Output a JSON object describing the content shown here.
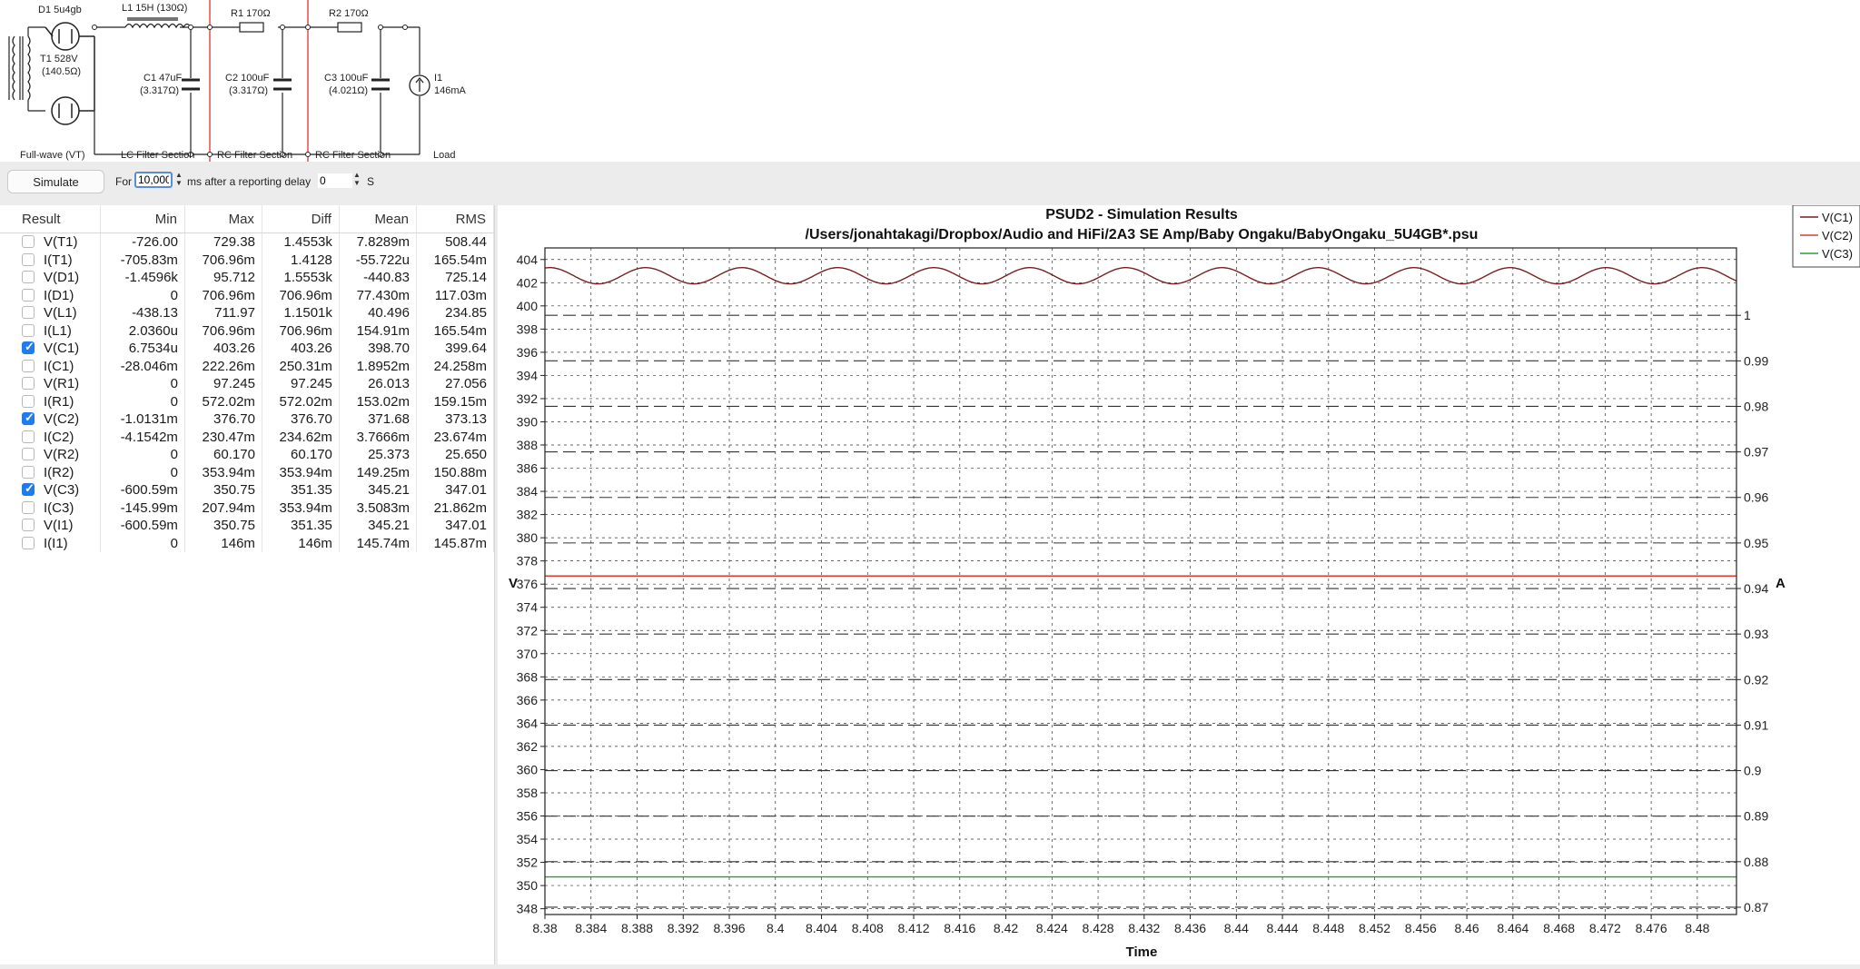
{
  "schematic": {
    "rectifier": "D1 5u4gb",
    "transformer": "T1 528V",
    "transformer_r": "(140.5Ω)",
    "inductor": "L1 15H (130Ω)",
    "r1": "R1 170Ω",
    "r2": "R2 170Ω",
    "c1": "C1 47uF",
    "c1_esr": "(3.317Ω)",
    "c2": "C2 100uF",
    "c2_esr": "(3.317Ω)",
    "c3": "C3 100uF",
    "c3_esr": "(4.021Ω)",
    "load": "I1",
    "load_current": "146mA",
    "sections": [
      "Full-wave (VT)",
      "LC Filter Section",
      "RC Filter Section",
      "RC Filter Section",
      "Load"
    ]
  },
  "controls": {
    "simulate_label": "Simulate",
    "for_label": "For",
    "duration_value": "10,000",
    "mid_label": "ms after a reporting delay",
    "delay_value": "0",
    "unit_label": "S"
  },
  "results": {
    "columns": [
      "Result",
      "Min",
      "Max",
      "Diff",
      "Mean",
      "RMS"
    ],
    "rows": [
      {
        "name": "V(T1)",
        "checked": false,
        "min": "-726.00",
        "max": "729.38",
        "diff": "1.4553k",
        "mean": "7.8289m",
        "rms": "508.44"
      },
      {
        "name": "I(T1)",
        "checked": false,
        "min": "-705.83m",
        "max": "706.96m",
        "diff": "1.4128",
        "mean": "-55.722u",
        "rms": "165.54m"
      },
      {
        "name": "V(D1)",
        "checked": false,
        "min": "-1.4596k",
        "max": "95.712",
        "diff": "1.5553k",
        "mean": "-440.83",
        "rms": "725.14"
      },
      {
        "name": "I(D1)",
        "checked": false,
        "min": "0",
        "max": "706.96m",
        "diff": "706.96m",
        "mean": "77.430m",
        "rms": "117.03m"
      },
      {
        "name": "V(L1)",
        "checked": false,
        "min": "-438.13",
        "max": "711.97",
        "diff": "1.1501k",
        "mean": "40.496",
        "rms": "234.85"
      },
      {
        "name": "I(L1)",
        "checked": false,
        "min": "2.0360u",
        "max": "706.96m",
        "diff": "706.96m",
        "mean": "154.91m",
        "rms": "165.54m"
      },
      {
        "name": "V(C1)",
        "checked": true,
        "min": "6.7534u",
        "max": "403.26",
        "diff": "403.26",
        "mean": "398.70",
        "rms": "399.64"
      },
      {
        "name": "I(C1)",
        "checked": false,
        "min": "-28.046m",
        "max": "222.26m",
        "diff": "250.31m",
        "mean": "1.8952m",
        "rms": "24.258m"
      },
      {
        "name": "V(R1)",
        "checked": false,
        "min": "0",
        "max": "97.245",
        "diff": "97.245",
        "mean": "26.013",
        "rms": "27.056"
      },
      {
        "name": "I(R1)",
        "checked": false,
        "min": "0",
        "max": "572.02m",
        "diff": "572.02m",
        "mean": "153.02m",
        "rms": "159.15m"
      },
      {
        "name": "V(C2)",
        "checked": true,
        "min": "-1.0131m",
        "max": "376.70",
        "diff": "376.70",
        "mean": "371.68",
        "rms": "373.13"
      },
      {
        "name": "I(C2)",
        "checked": false,
        "min": "-4.1542m",
        "max": "230.47m",
        "diff": "234.62m",
        "mean": "3.7666m",
        "rms": "23.674m"
      },
      {
        "name": "V(R2)",
        "checked": false,
        "min": "0",
        "max": "60.170",
        "diff": "60.170",
        "mean": "25.373",
        "rms": "25.650"
      },
      {
        "name": "I(R2)",
        "checked": false,
        "min": "0",
        "max": "353.94m",
        "diff": "353.94m",
        "mean": "149.25m",
        "rms": "150.88m"
      },
      {
        "name": "V(C3)",
        "checked": true,
        "min": "-600.59m",
        "max": "350.75",
        "diff": "351.35",
        "mean": "345.21",
        "rms": "347.01"
      },
      {
        "name": "I(C3)",
        "checked": false,
        "min": "-145.99m",
        "max": "207.94m",
        "diff": "353.94m",
        "mean": "3.5083m",
        "rms": "21.862m"
      },
      {
        "name": "V(I1)",
        "checked": false,
        "min": "-600.59m",
        "max": "350.75",
        "diff": "351.35",
        "mean": "345.21",
        "rms": "347.01"
      },
      {
        "name": "I(I1)",
        "checked": false,
        "min": "0",
        "max": "146m",
        "diff": "146m",
        "mean": "145.74m",
        "rms": "145.87m"
      }
    ]
  },
  "colors": {
    "v_c1": "#7a1f1f",
    "v_c2": "#e0392b",
    "v_c3": "#2e9a3e",
    "section_divider": "#e02020"
  },
  "chart_data": {
    "type": "line",
    "title": "PSUD2 - Simulation Results",
    "subtitle": "/Users/jonahtakagi/Dropbox/Audio and HiFi/2A3 SE Amp/Baby Ongaku/BabyOngaku_5U4GB*.psu",
    "xlabel": "Time",
    "ylabel": "V",
    "y2label": "A",
    "xlim": [
      8.38,
      8.4834
    ],
    "ylim": [
      347.5,
      405
    ],
    "y2lim": [
      0.8684,
      1.0148
    ],
    "x_ticks": [
      "8.38",
      "8.384",
      "8.388",
      "8.392",
      "8.396",
      "8.4",
      "8.404",
      "8.408",
      "8.412",
      "8.416",
      "8.42",
      "8.424",
      "8.428",
      "8.432",
      "8.436",
      "8.44",
      "8.444",
      "8.448",
      "8.452",
      "8.456",
      "8.46",
      "8.464",
      "8.468",
      "8.472",
      "8.476",
      "8.48"
    ],
    "y_ticks": [
      "348",
      "350",
      "352",
      "354",
      "356",
      "358",
      "360",
      "362",
      "364",
      "366",
      "368",
      "370",
      "372",
      "374",
      "376",
      "378",
      "380",
      "382",
      "384",
      "386",
      "388",
      "390",
      "392",
      "394",
      "396",
      "398",
      "400",
      "402",
      "404"
    ],
    "y2_ticks": [
      "0.87",
      "0.88",
      "0.89",
      "0.9",
      "0.91",
      "0.92",
      "0.93",
      "0.94",
      "0.95",
      "0.96",
      "0.97",
      "0.98",
      "0.99",
      "1"
    ],
    "grid": true,
    "legend_position": "top-right",
    "series": [
      {
        "name": "V(C1)",
        "x": [
          8.38,
          8.4834
        ],
        "ripple_period": 0.008333,
        "ripple_center": 402.6,
        "ripple_amplitude": 0.7
      },
      {
        "name": "V(C2)",
        "x": [
          8.38,
          8.4834
        ],
        "y": [
          376.7,
          376.7
        ]
      },
      {
        "name": "V(C3)",
        "x": [
          8.38,
          8.4834
        ],
        "y": [
          350.75,
          350.75
        ]
      }
    ]
  }
}
